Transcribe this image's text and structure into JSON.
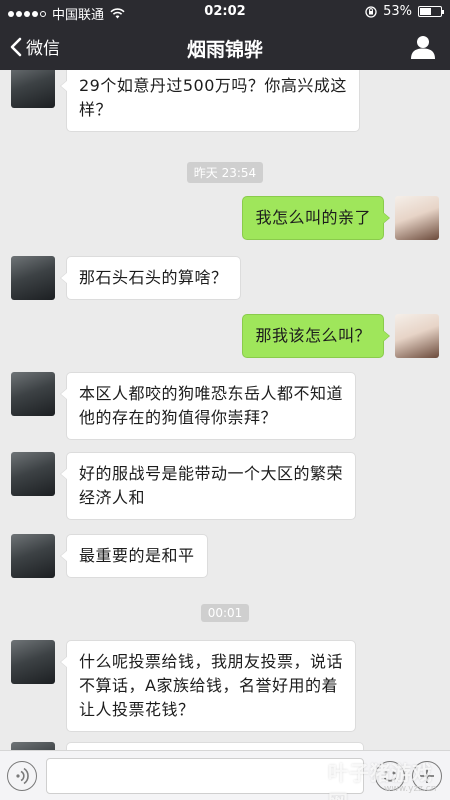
{
  "status_bar": {
    "carrier": "中国联通",
    "time": "02:02",
    "battery": "53%",
    "battery_level": 0.53
  },
  "nav": {
    "back_label": "微信",
    "title": "烟雨锦骅"
  },
  "messages": [
    {
      "side": "left",
      "text_lines": [
        "29个如意丹过500万吗？你高兴成这",
        "样？"
      ]
    },
    {
      "timestamp": "昨天 23:54"
    },
    {
      "side": "right",
      "text_lines": [
        "我怎么叫的亲了"
      ]
    },
    {
      "side": "left",
      "text_lines": [
        "那石头石头的算啥？"
      ]
    },
    {
      "side": "right",
      "text_lines": [
        "那我该怎么叫？"
      ]
    },
    {
      "side": "left",
      "text_lines": [
        "本区人都咬的狗唯恐东岳人都不知道",
        "他的存在的狗值得你崇拜？"
      ]
    },
    {
      "side": "left",
      "text_lines": [
        "好的服战号是能带动一个大区的繁荣",
        "经济人和"
      ]
    },
    {
      "side": "left",
      "text_lines": [
        "最重要的是和平"
      ]
    },
    {
      "timestamp": "00:01"
    },
    {
      "side": "left",
      "text_lines": [
        "什么呢投票给钱，我朋友投票，说话",
        "不算话，A家族给钱，名誉好用的着",
        "让人投票花钱？"
      ]
    }
  ],
  "watermark": {
    "text": "叶子猪游戏网",
    "url": "www.yzz.cn"
  }
}
